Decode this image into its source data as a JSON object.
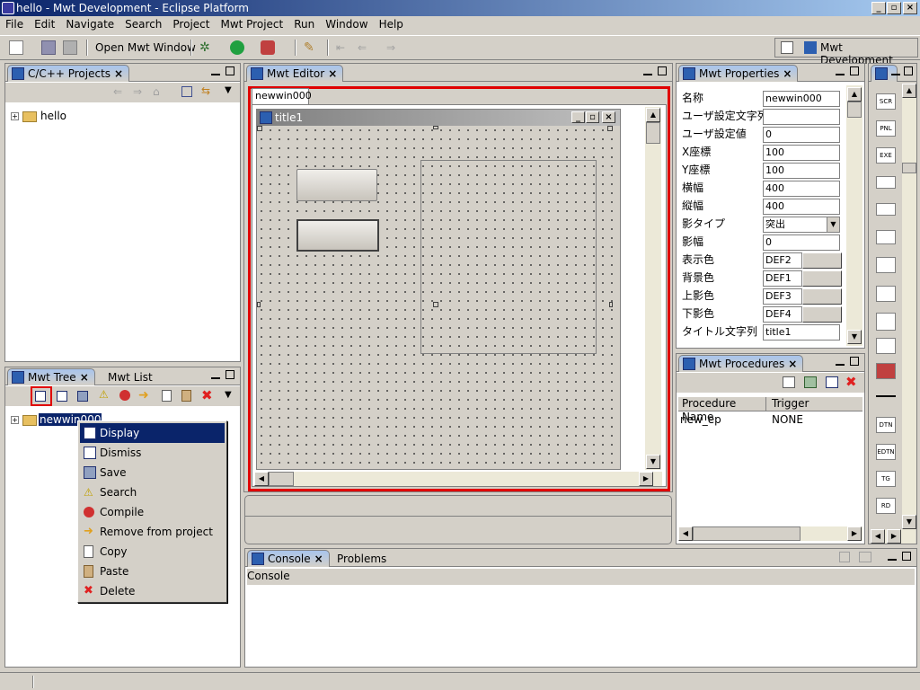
{
  "window": {
    "title": "hello - Mwt Development - Eclipse Platform"
  },
  "menu": [
    "File",
    "Edit",
    "Navigate",
    "Search",
    "Project",
    "Mwt Project",
    "Run",
    "Window",
    "Help"
  ],
  "toolbar": {
    "open_window": "Open Mwt Window",
    "perspective": "Mwt Development"
  },
  "projects_panel": {
    "tab": "C/C++ Projects",
    "tree_item": "hello"
  },
  "mwt_tree_panel": {
    "tab_active": "Mwt Tree",
    "tab_other": "Mwt List",
    "tree_item": "newwin000"
  },
  "context_menu": [
    {
      "label": "Display",
      "icon": "window-icon"
    },
    {
      "label": "Dismiss",
      "icon": "window-icon"
    },
    {
      "label": "Save",
      "icon": "save-icon"
    },
    {
      "label": "Search",
      "icon": "warning-icon"
    },
    {
      "label": "Compile",
      "icon": "error-icon"
    },
    {
      "label": "Remove from project",
      "icon": "arrow-right-icon"
    },
    {
      "label": "Copy",
      "icon": "copy-icon"
    },
    {
      "label": "Paste",
      "icon": "paste-icon"
    },
    {
      "label": "Delete",
      "icon": "delete-icon"
    }
  ],
  "editor": {
    "tab": "Mwt Editor",
    "doc_tab": "newwin000",
    "window_title": "title1"
  },
  "properties": {
    "tab": "Mwt Properties",
    "rows": [
      {
        "name": "名称",
        "value": "newwin000"
      },
      {
        "name": "ユーザ設定文字列",
        "value": ""
      },
      {
        "name": "ユーザ設定値",
        "value": "0"
      },
      {
        "name": "X座標",
        "value": "100"
      },
      {
        "name": "Y座標",
        "value": "100"
      },
      {
        "name": "横幅",
        "value": "400"
      },
      {
        "name": "縦幅",
        "value": "400"
      },
      {
        "name": "影タイプ",
        "value": "突出"
      },
      {
        "name": "影幅",
        "value": "0"
      },
      {
        "name": "表示色",
        "value": "DEF2"
      },
      {
        "name": "背景色",
        "value": "DEF1"
      },
      {
        "name": "上影色",
        "value": "DEF3"
      },
      {
        "name": "下影色",
        "value": "DEF4"
      },
      {
        "name": "タイトル文字列",
        "value": "title1"
      }
    ]
  },
  "procedures": {
    "tab": "Mwt Procedures",
    "columns": [
      "Procedure Name",
      "Trigger"
    ],
    "rows": [
      {
        "name": "new_ep",
        "trigger": "NONE"
      }
    ]
  },
  "console": {
    "tab_active": "Console",
    "tab_other": "Problems",
    "label": "Console"
  },
  "palette": [
    "SCR",
    "PNL",
    "EXE",
    "",
    "",
    "",
    "",
    "",
    "",
    "",
    "",
    "",
    "",
    "",
    "DTN",
    "EDTN",
    "TG",
    "RD"
  ],
  "colors": {
    "selection": "#0a246a",
    "highlight_border": "#e00000",
    "title_gradient_start": "#0a246a",
    "title_gradient_end": "#a6caf0"
  }
}
